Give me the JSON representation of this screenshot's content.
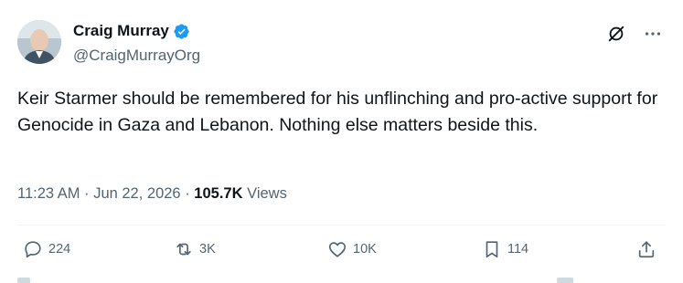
{
  "author": {
    "display_name": "Craig Murray",
    "handle": "@CraigMurrayOrg",
    "verified": true
  },
  "tweet": {
    "text": "Keir Starmer should be remembered for his unflinching and pro-active support for Genocide in Gaza and Lebanon. Nothing else matters beside this.",
    "time": "11:23 AM",
    "date": "Jun 22, 2026",
    "separator": "·",
    "views_count": "105.7K",
    "views_label": "Views"
  },
  "actions": {
    "replies": "224",
    "reposts": "3K",
    "likes": "10K",
    "bookmarks": "114"
  },
  "colors": {
    "text_primary": "#0f1419",
    "text_secondary": "#536471",
    "verified_blue": "#1d9bf0",
    "divider": "#eff3f4"
  },
  "icons": {
    "grok": "grok-icon",
    "more": "more-icon",
    "reply": "reply-icon",
    "repost": "repost-icon",
    "like": "like-icon",
    "bookmark": "bookmark-icon",
    "share": "share-icon"
  }
}
